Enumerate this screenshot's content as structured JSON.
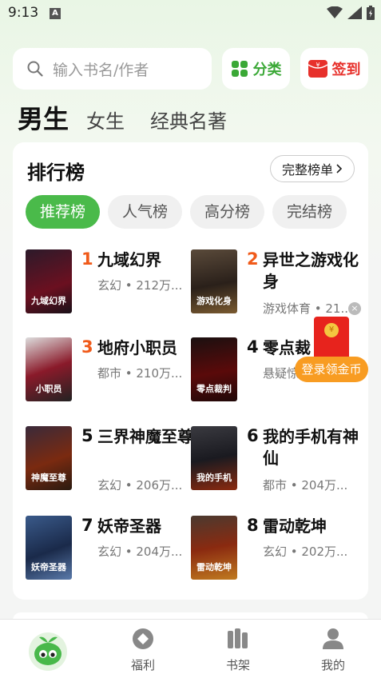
{
  "status_bar": {
    "time": "9:13",
    "badge": "A"
  },
  "search": {
    "placeholder": "输入书名/作者",
    "icon": "search-icon"
  },
  "header_buttons": {
    "category": {
      "label": "分类",
      "icon": "grid-icon",
      "color": "#3aa836"
    },
    "signin": {
      "label": "签到",
      "icon": "red-envelope-icon",
      "color": "#e7302b"
    }
  },
  "gender_tabs": [
    {
      "label": "男生",
      "active": true
    },
    {
      "label": "女生",
      "active": false
    },
    {
      "label": "经典名著",
      "active": false
    }
  ],
  "ranking": {
    "title": "排行榜",
    "full_list_label": "完整榜单",
    "tabs": [
      {
        "label": "推荐榜",
        "active": true
      },
      {
        "label": "人气榜",
        "active": false
      },
      {
        "label": "高分榜",
        "active": false
      },
      {
        "label": "完结榜",
        "active": false
      }
    ],
    "books": [
      {
        "rank": "1",
        "title": "九域幻界",
        "meta": "玄幻 • 212万...",
        "cover_text": "九域幻界"
      },
      {
        "rank": "2",
        "title": "异世之游戏化身",
        "meta": "游戏体育 • 21...",
        "cover_text": "游戏化身"
      },
      {
        "rank": "3",
        "title": "地府小职员",
        "meta": "都市 • 210万...",
        "cover_text": "小职员"
      },
      {
        "rank": "4",
        "title": "零点裁",
        "meta": "悬疑惊",
        "cover_text": "零点裁判"
      },
      {
        "rank": "5",
        "title": "三界神魔至尊",
        "meta": "玄幻 • 206万...",
        "cover_text": "神魔至尊"
      },
      {
        "rank": "6",
        "title": "我的手机有神仙",
        "meta": "都市 • 204万...",
        "cover_text": "我的手机"
      },
      {
        "rank": "7",
        "title": "妖帝圣器",
        "meta": "玄幻 • 204万...",
        "cover_text": "妖帝圣器"
      },
      {
        "rank": "8",
        "title": "雷动乾坤",
        "meta": "玄幻 • 202万...",
        "cover_text": "雷动乾坤"
      }
    ]
  },
  "floating_ad": {
    "label": "登录领金币",
    "close": "×",
    "coin": "¥"
  },
  "bottom_nav": [
    {
      "label": "",
      "icon": "bean-mascot-icon"
    },
    {
      "label": "福利",
      "icon": "diamond-icon"
    },
    {
      "label": "书架",
      "icon": "bookshelf-icon"
    },
    {
      "label": "我的",
      "icon": "user-icon"
    }
  ],
  "colors": {
    "accent_green": "#4aba4a",
    "rank_orange": "#f05a1a",
    "ad_orange": "#f89c22"
  }
}
